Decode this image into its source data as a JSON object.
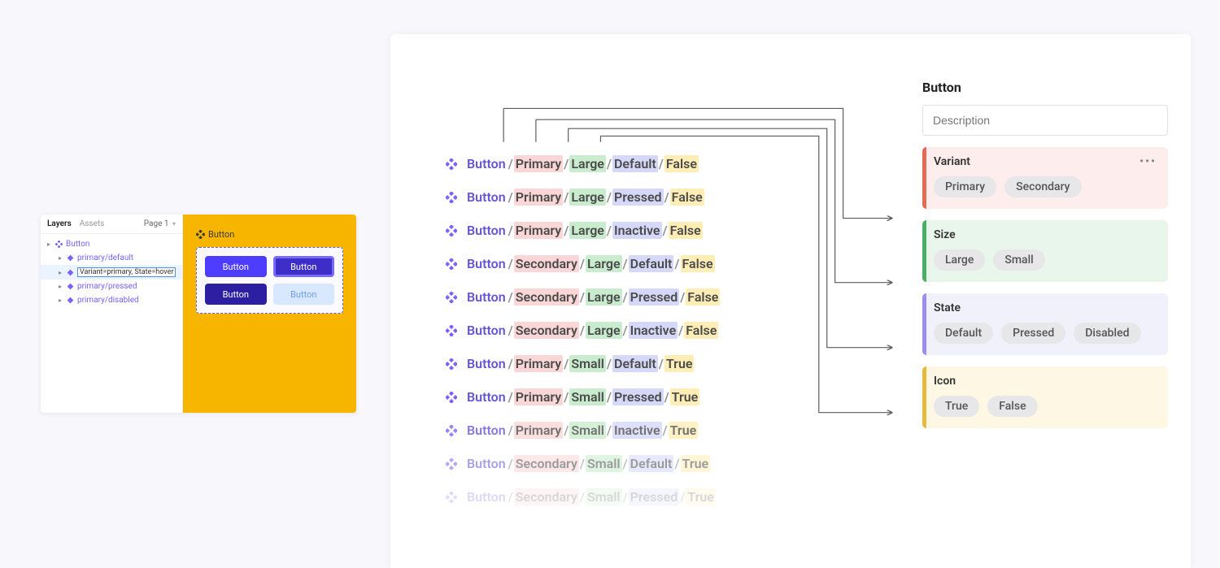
{
  "left": {
    "tabs": {
      "layers": "Layers",
      "assets": "Assets"
    },
    "page_label": "Page 1",
    "tree": {
      "root": "Button",
      "children": [
        "primary/default",
        "Variant=primary, State=hover",
        "primary/pressed",
        "primary/disabled"
      ]
    },
    "canvas": {
      "component_label": "Button",
      "button_text": "Button"
    }
  },
  "right": {
    "title": "Button",
    "description_placeholder": "Description",
    "variants": [
      {
        "name": "Button",
        "variant": "Primary",
        "size": "Large",
        "state": "Default",
        "icon": "False"
      },
      {
        "name": "Button",
        "variant": "Primary",
        "size": "Large",
        "state": "Pressed",
        "icon": "False"
      },
      {
        "name": "Button",
        "variant": "Primary",
        "size": "Large",
        "state": "Inactive",
        "icon": "False"
      },
      {
        "name": "Button",
        "variant": "Secondary",
        "size": "Large",
        "state": "Default",
        "icon": "False"
      },
      {
        "name": "Button",
        "variant": "Secondary",
        "size": "Large",
        "state": "Pressed",
        "icon": "False"
      },
      {
        "name": "Button",
        "variant": "Secondary",
        "size": "Large",
        "state": "Inactive",
        "icon": "False"
      },
      {
        "name": "Button",
        "variant": "Primary",
        "size": "Small",
        "state": "Default",
        "icon": "True"
      },
      {
        "name": "Button",
        "variant": "Primary",
        "size": "Small",
        "state": "Pressed",
        "icon": "True"
      },
      {
        "name": "Button",
        "variant": "Primary",
        "size": "Small",
        "state": "Inactive",
        "icon": "True"
      },
      {
        "name": "Button",
        "variant": "Secondary",
        "size": "Small",
        "state": "Default",
        "icon": "True"
      },
      {
        "name": "Button",
        "variant": "Secondary",
        "size": "Small",
        "state": "Pressed",
        "icon": "True"
      }
    ],
    "properties": [
      {
        "key": "variant",
        "label": "Variant",
        "options": [
          "Primary",
          "Secondary"
        ],
        "show_menu": true
      },
      {
        "key": "size",
        "label": "Size",
        "options": [
          "Large",
          "Small"
        ]
      },
      {
        "key": "state",
        "label": "State",
        "options": [
          "Default",
          "Pressed",
          "Disabled"
        ]
      },
      {
        "key": "icon",
        "label": "Icon",
        "options": [
          "True",
          "False"
        ]
      }
    ]
  }
}
